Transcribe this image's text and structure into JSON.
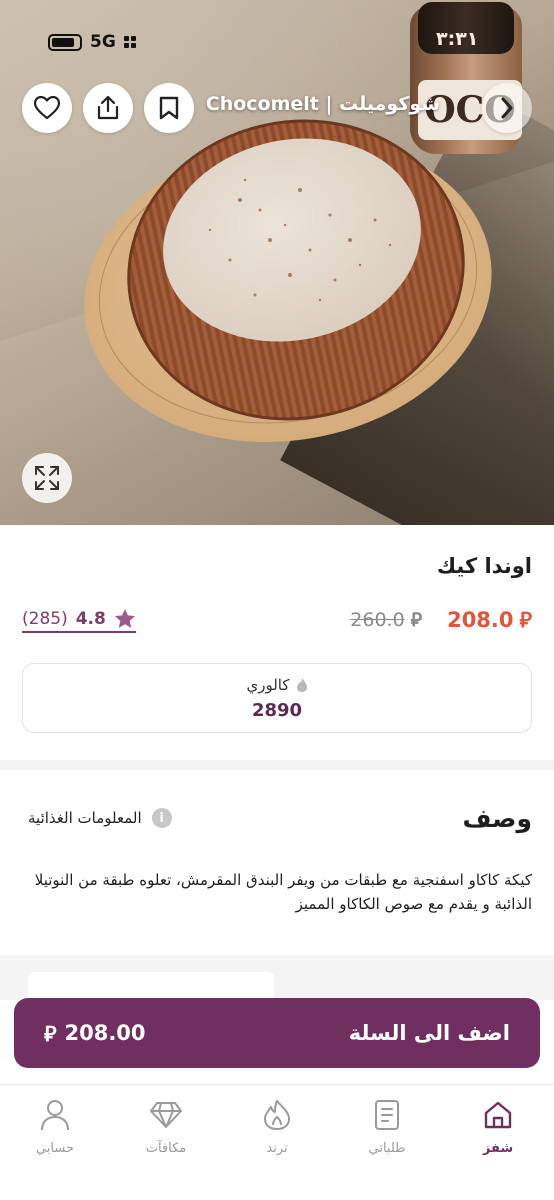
{
  "status_bar": {
    "network": "5G",
    "time": "٣:٣١"
  },
  "header": {
    "store_title": "شوكوميلت | Chocomelt",
    "icons": [
      "back-chevron-icon",
      "bookmark-icon",
      "share-icon",
      "heart-icon"
    ]
  },
  "hero": {
    "jar_label": "OCO"
  },
  "product": {
    "name": "اوندا كيك",
    "price_current": "208.0",
    "price_original": "260.0",
    "currency_symbol": "⃁",
    "rating": "4.8",
    "rating_count": "(285)",
    "calories_label": "كالوري",
    "calories_value": "2890"
  },
  "description": {
    "title": "وصف",
    "nutrition_link": "المعلومات الغذائية",
    "text": "كيكة كاكاو اسفنجية مع طبقات من ويفر البندق المقرمش، تعلوه طبقة من النوتيلا الذائبة و يقدم مع صوص الكاكاو المميز"
  },
  "cart": {
    "label": "اضف الى السلة",
    "price": "208.00"
  },
  "bottom_nav": {
    "items": [
      {
        "label": "حسابي",
        "icon": "user-icon"
      },
      {
        "label": "مكافآت",
        "icon": "diamond-icon"
      },
      {
        "label": "ترند",
        "icon": "flame-icon"
      },
      {
        "label": "طلباتي",
        "icon": "orders-icon"
      },
      {
        "label": "شفز",
        "icon": "home-icon"
      }
    ],
    "active_index": 4
  },
  "colors": {
    "brand": "#6f3060",
    "price": "#e0563d",
    "star": "#9b5a8c"
  }
}
